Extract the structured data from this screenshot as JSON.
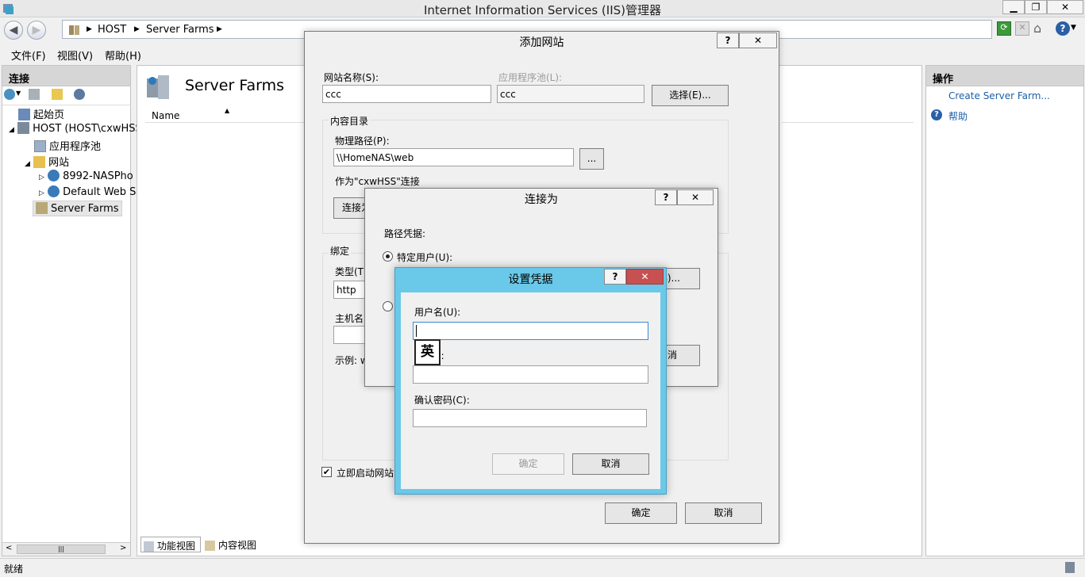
{
  "window": {
    "title": "Internet Information Services (IIS)管理器"
  },
  "address": {
    "crumbs": [
      "HOST",
      "Server Farms"
    ]
  },
  "menu": [
    "文件(F)",
    "视图(V)",
    "帮助(H)"
  ],
  "connections": {
    "header": "连接",
    "tree": [
      "起始页",
      "HOST (HOST\\cxwHSS",
      "应用程序池",
      "网站",
      "8992-NASPho",
      "Default Web S",
      "Server Farms"
    ]
  },
  "center": {
    "title": "Server Farms",
    "column_name": "Name",
    "tab_feature": "功能视图",
    "tab_content": "内容视图"
  },
  "actions": {
    "header": "操作",
    "create": "Create Server Farm...",
    "help": "帮助"
  },
  "status": "就绪",
  "add_site": {
    "title": "添加网站",
    "site_name_label": "网站名称(S):",
    "site_name_value": "ccc",
    "app_pool_label": "应用程序池(L):",
    "app_pool_value": "ccc",
    "select_btn": "选择(E)...",
    "content_group": "内容目录",
    "physical_path_label": "物理路径(P):",
    "physical_path_value": "\\\\HomeNAS\\web",
    "browse_btn": "...",
    "connect_as_text": "作为\"cxwHSS\"连接",
    "connect_btn": "连接为",
    "binding_group": "绑定",
    "type_label": "类型(T)",
    "type_value": "http",
    "host_label": "主机名",
    "example_label": "示例: w",
    "start_checkbox": "立即启动网站",
    "ok": "确定",
    "cancel": "取消"
  },
  "connect_as": {
    "title": "连接为",
    "path_cred_label": "路径凭据:",
    "specific_user": "特定用户(U):",
    "set_btn_tail": "S)...",
    "cancel_tail": "消"
  },
  "credentials": {
    "title": "设置凭据",
    "username_label": "用户名(U):",
    "password_label_tail": "):",
    "confirm_label": "确认密码(C):",
    "ime": "英",
    "ok": "确定",
    "cancel": "取消"
  },
  "colors": {
    "accent": "#6ac8e8",
    "close_red": "#c75050",
    "link": "#1b5fa8"
  }
}
